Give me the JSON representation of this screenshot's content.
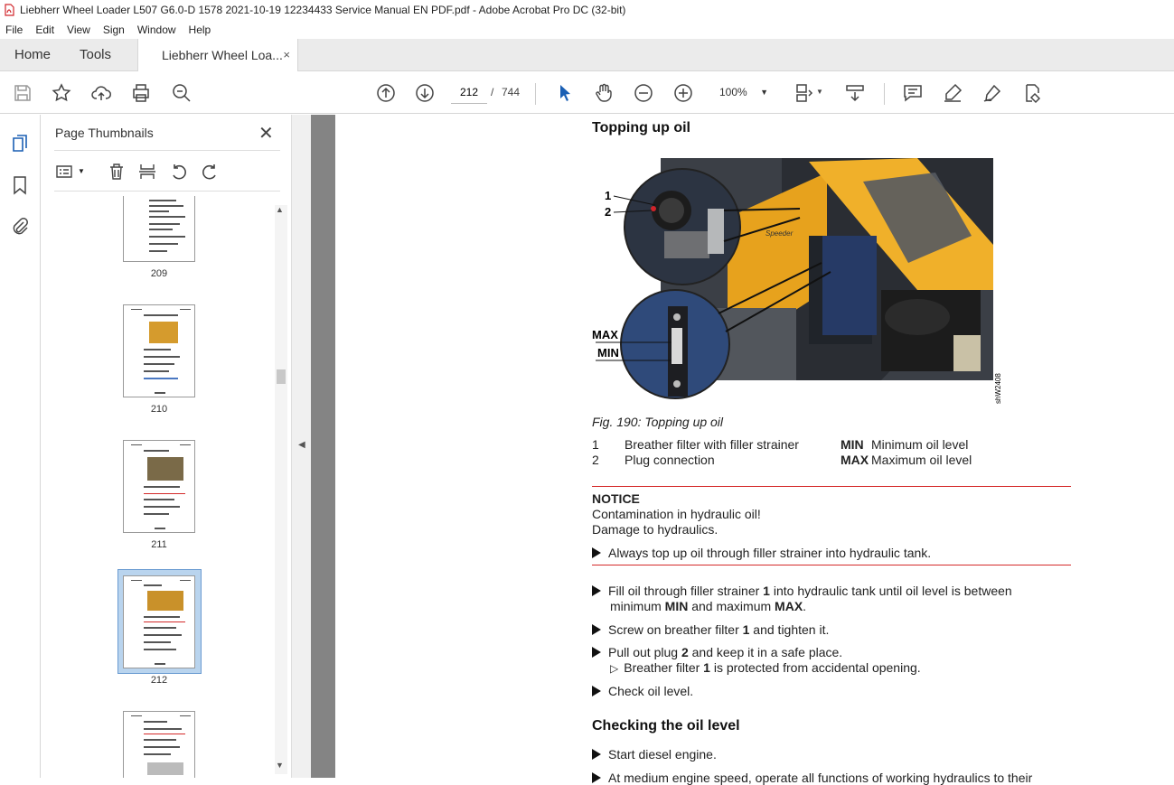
{
  "window": {
    "title": "Liebherr Wheel Loader L507 G6.0-D 1578 2021-10-19 12234433 Service Manual EN PDF.pdf - Adobe Acrobat Pro DC (32-bit)"
  },
  "menu": [
    "File",
    "Edit",
    "View",
    "Sign",
    "Window",
    "Help"
  ],
  "tabs": {
    "home": "Home",
    "tools": "Tools",
    "document": "Liebherr Wheel Loa...",
    "close": "×"
  },
  "toolbar": {
    "current_page": "212",
    "separator": "/",
    "total_pages": "744",
    "zoom": "100%"
  },
  "thumbnails": {
    "title": "Page Thumbnails",
    "close": "✕",
    "pages": [
      {
        "label": "209"
      },
      {
        "label": "210"
      },
      {
        "label": "211"
      },
      {
        "label": "212",
        "selected": true
      },
      {
        "label": ""
      }
    ]
  },
  "document": {
    "heading1": "Topping up oil",
    "figure_labels": {
      "label1": "1",
      "label2": "2",
      "max": "MAX",
      "min": "MIN",
      "code": "shW2408",
      "brand": "Speeder"
    },
    "caption": "Fig. 190: Topping up oil",
    "legend": [
      {
        "key": "1",
        "text": "Breather filter with filler strainer"
      },
      {
        "key": "2",
        "text": "Plug connection"
      },
      {
        "key": "MIN",
        "text": "Minimum oil level"
      },
      {
        "key": "MAX",
        "text": "Maximum oil level"
      }
    ],
    "notice": {
      "title": "NOTICE",
      "line1": "Contamination in hydraulic oil!",
      "line2": "Damage to hydraulics.",
      "action": "Always top up oil through filler strainer into hydraulic tank."
    },
    "steps": {
      "s1a": "Fill oil through filler strainer ",
      "s1b": "1",
      "s1c": " into hydraulic tank until oil level is between",
      "s1d": "minimum ",
      "s1e": "MIN",
      "s1f": " and maximum ",
      "s1g": "MAX",
      "s1h": ".",
      "s2a": "Screw on breather filter ",
      "s2b": "1",
      "s2c": " and tighten it.",
      "s3a": "Pull out plug ",
      "s3b": "2",
      "s3c": " and keep it in a safe place.",
      "s3r1": "Breather filter ",
      "s3r2": "1",
      "s3r3": " is protected from accidental opening.",
      "s4": "Check oil level."
    },
    "heading2": "Checking the oil level",
    "steps2": {
      "c1": "Start diesel engine.",
      "c2": "At medium engine speed, operate all functions of working hydraulics to their"
    }
  },
  "colors": {
    "accent_red": "#d42a2a",
    "loader_yellow": "#e8a21c",
    "selection_blue": "#b9d4ee"
  }
}
